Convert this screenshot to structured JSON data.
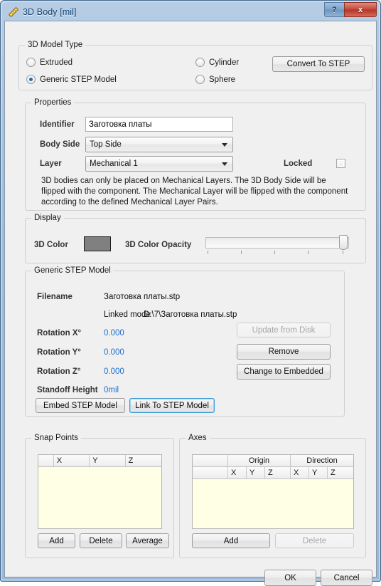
{
  "window": {
    "title": "3D Body [mil]",
    "icon": "ruler-triangle-icon",
    "help_label": "?",
    "close_label": "x"
  },
  "model_type": {
    "legend": "3D Model Type",
    "options": [
      {
        "label": "Extruded",
        "selected": false
      },
      {
        "label": "Generic STEP Model",
        "selected": true
      },
      {
        "label": "Cylinder",
        "selected": false
      },
      {
        "label": "Sphere",
        "selected": false
      }
    ],
    "convert_button": "Convert To STEP"
  },
  "properties": {
    "legend": "Properties",
    "identifier_label": "Identifier",
    "identifier_value": "Заготовка платы",
    "body_side_label": "Body Side",
    "body_side_value": "Top Side",
    "layer_label": "Layer",
    "layer_value": "Mechanical 1",
    "locked_label": "Locked",
    "locked_checked": false,
    "note": "3D bodies can only be placed on Mechanical Layers. The 3D Body Side will be flipped with the component. The Mechanical Layer will be flipped with the component according to the defined Mechanical Layer Pairs."
  },
  "display": {
    "legend": "Display",
    "color_label": "3D Color",
    "color_value": "#808080",
    "opacity_label": "3D Color Opacity",
    "opacity_percent": 100
  },
  "step_model": {
    "legend": "Generic STEP Model",
    "filename_label": "Filename",
    "filename_value": "Заготовка платы.stp",
    "linked_mode_label": "Linked mode",
    "linked_path_value": "D:\\7\\Заготовка платы.stp",
    "rotation_x_label": "Rotation X°",
    "rotation_x_value": "0.000",
    "rotation_y_label": "Rotation Y°",
    "rotation_y_value": "0.000",
    "rotation_z_label": "Rotation Z°",
    "rotation_z_value": "0.000",
    "standoff_label": "Standoff Height",
    "standoff_value": "0mil",
    "embed_button": "Embed STEP Model",
    "link_button": "Link To STEP Model",
    "update_button": "Update from Disk",
    "update_disabled": true,
    "remove_button": "Remove",
    "change_button": "Change to Embedded"
  },
  "snap_points": {
    "legend": "Snap Points",
    "columns": [
      "",
      "X",
      "Y",
      "Z"
    ],
    "rows": [],
    "add_button": "Add",
    "delete_button": "Delete",
    "average_button": "Average"
  },
  "axes": {
    "legend": "Axes",
    "group_headers": [
      "",
      "Origin",
      "Direction"
    ],
    "sub_headers": [
      "",
      "X",
      "Y",
      "Z",
      "X",
      "Y",
      "Z"
    ],
    "rows": [],
    "add_button": "Add",
    "delete_button": "Delete",
    "delete_disabled": true
  },
  "footer": {
    "ok_button": "OK",
    "cancel_button": "Cancel"
  }
}
